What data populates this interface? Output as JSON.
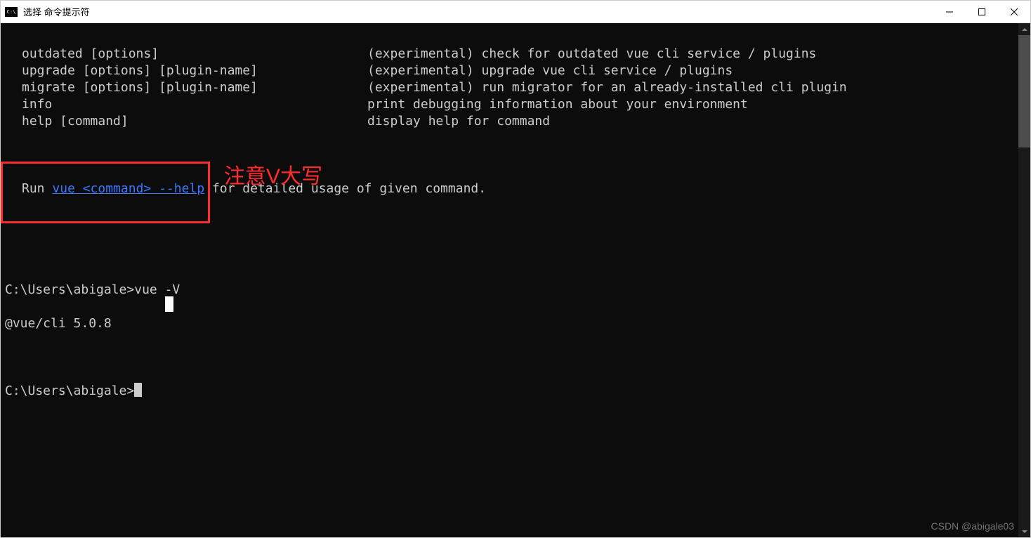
{
  "window": {
    "title": "选择 命令提示符"
  },
  "terminal": {
    "help_rows": [
      {
        "cmd": "outdated [options]",
        "desc": "(experimental) check for outdated vue cli service / plugins"
      },
      {
        "cmd": "upgrade [options] [plugin-name]",
        "desc": "(experimental) upgrade vue cli service / plugins"
      },
      {
        "cmd": "migrate [options] [plugin-name]",
        "desc": "(experimental) run migrator for an already-installed cli plugin"
      },
      {
        "cmd": "info",
        "desc": "print debugging information about your environment"
      },
      {
        "cmd": "help [command]",
        "desc": "display help for command"
      }
    ],
    "run_line_prefix": "Run ",
    "run_line_link": "vue <command> --help",
    "run_line_suffix": " for detailed usage of given command.",
    "prompt1_text": "C:\\Users\\abigale>vue -V",
    "version_output": "@vue/cli 5.0.8",
    "prompt2_text": "C:\\Users\\abigale>"
  },
  "annotation": {
    "note": "注意V大写"
  },
  "watermark": "CSDN @abigale03"
}
